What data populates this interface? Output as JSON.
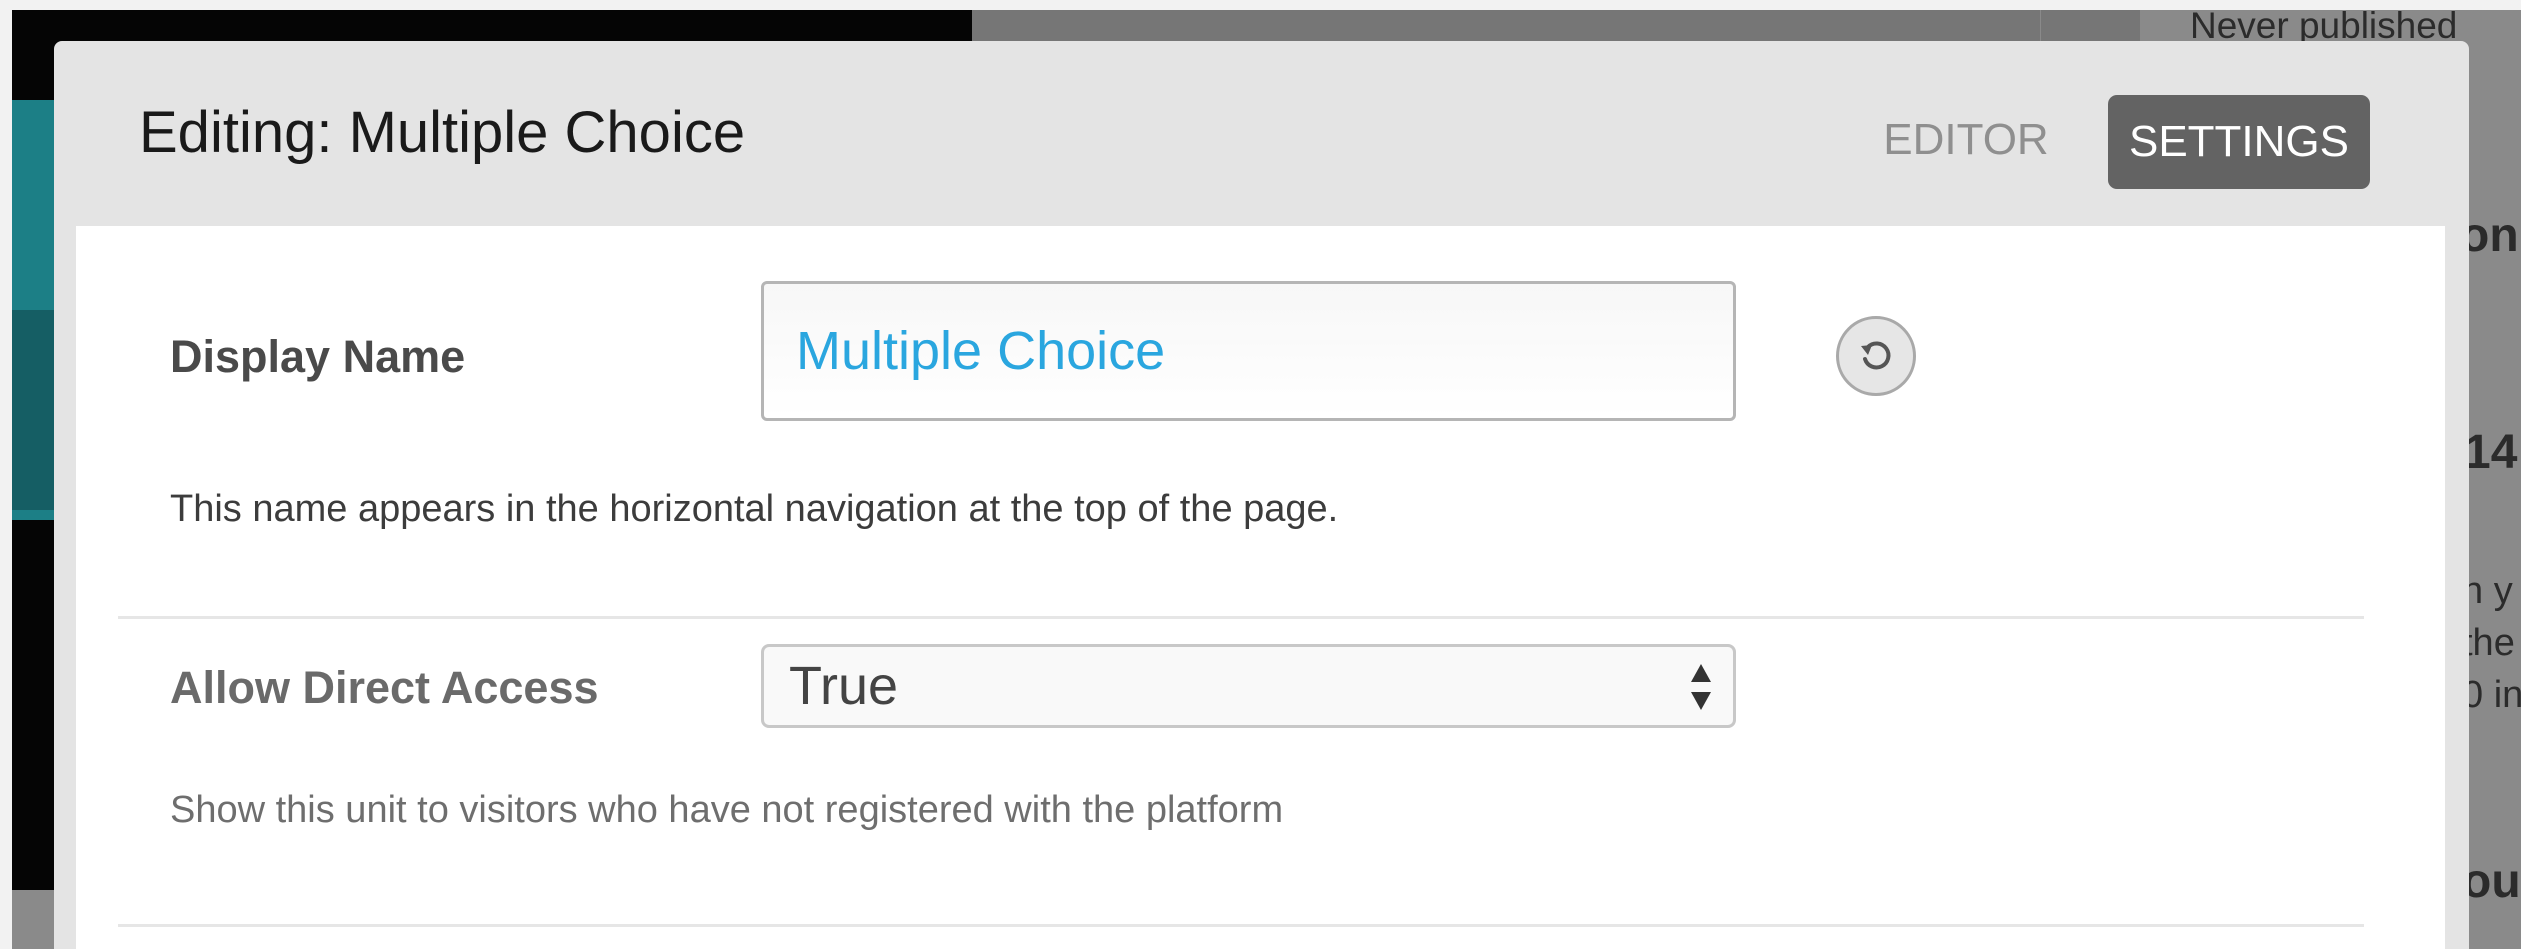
{
  "background": {
    "status_text": "Never published",
    "fragments": [
      "on",
      "14",
      "n y",
      "the",
      "0 in",
      "ou"
    ]
  },
  "modal": {
    "title": "Editing: Multiple Choice",
    "modes": {
      "editor_label": "EDITOR",
      "settings_label": "SETTINGS",
      "active": "SETTINGS"
    }
  },
  "fields": {
    "display_name": {
      "label": "Display Name",
      "value": "Multiple Choice",
      "help": "This name appears in the horizontal navigation at the top of the page."
    },
    "direct_access": {
      "label": "Allow Direct Access",
      "selected": "True",
      "help": "Show this unit to visitors who have not registered with the platform"
    }
  },
  "icons": {
    "reset": "reset-icon",
    "select_arrows": "select-arrows-icon"
  },
  "colors": {
    "accent_value": "#2aa6df",
    "active_tab_bg": "#636363"
  }
}
